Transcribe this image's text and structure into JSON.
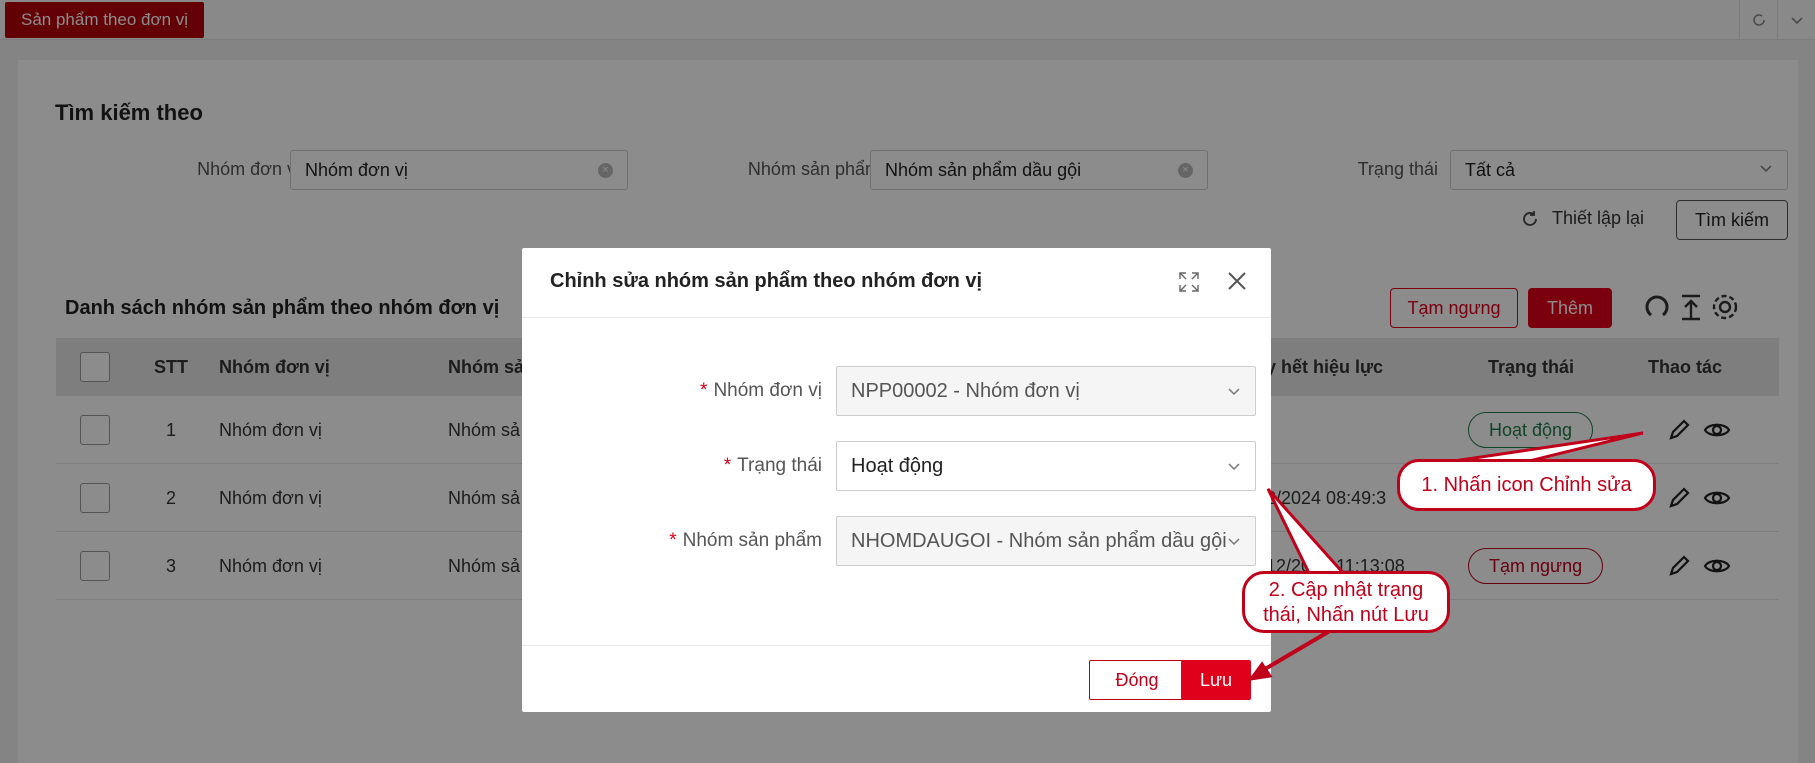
{
  "topbar": {
    "active_tab": "Sản phẩm theo đơn vị"
  },
  "search": {
    "title": "Tìm kiếm theo",
    "unit_group_label": "Nhóm đơn vị",
    "unit_group_value": "Nhóm đơn vị",
    "product_group_label": "Nhóm sản phẩm",
    "product_group_value": "Nhóm sản phẩm dầu gội",
    "status_label": "Trạng thái",
    "status_value": "Tất cả",
    "reset_label": "Thiết lập lại",
    "search_button": "Tìm kiếm"
  },
  "list": {
    "title": "Danh sách nhóm sản phẩm theo nhóm đơn vị",
    "pause_button": "Tạm ngưng",
    "add_button": "Thêm",
    "columns": {
      "stt": "STT",
      "unit_group": "Nhóm đơn vị",
      "product_group": "Nhóm sả",
      "expiry": "y hết hiệu lực",
      "status": "Trạng thái",
      "actions": "Thao tác"
    },
    "rows": [
      {
        "stt": "1",
        "unit_group": "Nhóm đơn vị",
        "product_group": "Nhóm sả",
        "expiry": "",
        "status": "Hoạt động"
      },
      {
        "stt": "2",
        "unit_group": "Nhóm đơn vị",
        "product_group": "Nhóm sả",
        "expiry": "2/2024 08:49:3",
        "status": ""
      },
      {
        "stt": "3",
        "unit_group": "Nhóm đơn vị",
        "product_group": "Nhóm sả",
        "expiry": "12/2024 11:13:08",
        "status": "Tạm ngưng"
      }
    ]
  },
  "modal": {
    "title": "Chỉnh sửa nhóm sản phẩm theo nhóm đơn vị",
    "required_mark": "*",
    "unit_group_label": "Nhóm đơn vị",
    "unit_group_value": "NPP00002 - Nhóm đơn vị",
    "status_label": "Trạng thái",
    "status_value": "Hoạt động",
    "product_group_label": "Nhóm sản phẩm",
    "product_group_value": "NHOMDAUGOI - Nhóm sản phẩm dầu gội",
    "close_button": "Đóng",
    "save_button": "Lưu"
  },
  "callouts": {
    "step1": "1. Nhấn icon Chỉnh sửa",
    "step2_line1": "2. Cập nhật trạng",
    "step2_line2": "thái, Nhấn nút Lưu"
  },
  "colors": {
    "brand_red": "#e0001b",
    "tab_red": "#b3000a",
    "active_green": "#1f7a4a"
  }
}
